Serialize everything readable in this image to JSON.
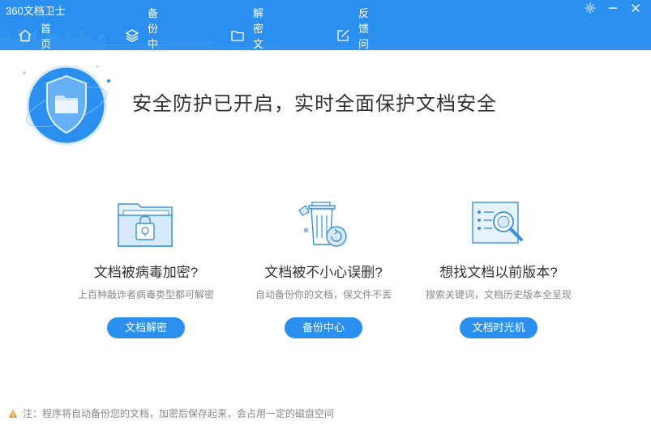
{
  "window": {
    "title": "360文档卫士",
    "controls": [
      {
        "icon": "gear-icon"
      },
      {
        "icon": "minimize-icon"
      },
      {
        "icon": "close-icon"
      }
    ]
  },
  "nav": {
    "items": [
      {
        "label": "首　页",
        "icon": "home-icon",
        "active": true
      },
      {
        "label": "备份中心",
        "icon": "layers-icon",
        "active": false
      },
      {
        "label": "解密文档",
        "icon": "folder-icon",
        "active": false
      },
      {
        "label": "反馈问题",
        "icon": "edit-icon",
        "active": false
      }
    ]
  },
  "hero": {
    "status_text": "安全防护已开启，实时全面保护文档安全",
    "badge_icon": "shield-folder-icon"
  },
  "cards": [
    {
      "title": "文档被病毒加密?",
      "description": "上百种敲诈者病毒类型都可解密",
      "button": "文档解密",
      "icon": "locked-folder-icon"
    },
    {
      "title": "文档被不小心误删?",
      "description": "自动备份你的文档，保文件不丢",
      "button": "备份中心",
      "icon": "trash-restore-icon"
    },
    {
      "title": "想找文档以前版本?",
      "description": "搜索关键词，文档历史版本全呈现",
      "button": "文档时光机",
      "icon": "search-document-icon"
    }
  ],
  "footer": {
    "note": "注：程序将自动备份您的文档，加密后保存起来，会占用一定的磁盘空间",
    "icon": "warning-icon"
  },
  "colors": {
    "accent": "#2b8ff0",
    "text": "#333333",
    "muted": "#888888",
    "warning": "#e8a23a"
  }
}
